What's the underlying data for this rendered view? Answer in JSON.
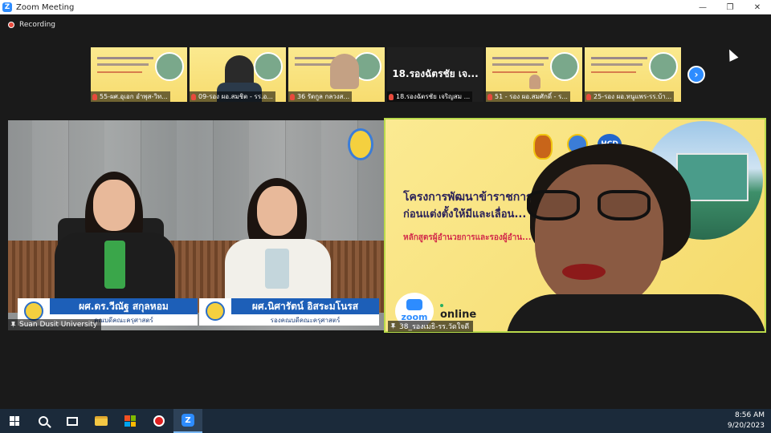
{
  "window": {
    "title": "Zoom Meeting",
    "logo_letter": "Z",
    "minimize": "—",
    "restore": "❐",
    "close": "✕"
  },
  "meeting": {
    "recording_label": "Recording",
    "thumbnails": [
      {
        "label": "55-ผศ.อุเอก อำพุส-วิท..."
      },
      {
        "label": "09-รอง ผอ.สมชิต - รร.อ..."
      },
      {
        "label": "36 รัตกูล กลวงส..."
      },
      {
        "label": "18.รองฉัตรชัย เจริญสม ...",
        "big_name": "18.รองฉัตรชัย เจ..."
      },
      {
        "label": "51 - รอง ผอ.สมศักดิ์ - ร..."
      },
      {
        "label": "25-รอง ผอ.หนูแพร-รร.บ้า..."
      }
    ],
    "next_arrow": "›",
    "left_video": {
      "nameplate_left_name": "ผศ.ดร.วีณัฐ สกุลหอม",
      "nameplate_left_role": "คณบดีคณะครุศาสตร์",
      "nameplate_right_name": "ผศ.นิศารัตน์ อิสระมโนรส",
      "nameplate_right_role": "รองคณบดีคณะครุศาสตร์",
      "participant_name": "Suan Dusit University"
    },
    "right_video": {
      "title_line1": "โครงการพัฒนาข้าราชการค...",
      "title_line2": "ก่อนแต่งตั้งให้มีและเลื่อน...",
      "subtitle": "หลักสูตรผู้อำนวยการและรองผู้อำน...",
      "hcd_label": "HCD",
      "zoom_label": "zoom",
      "online_label": "online",
      "participant_name": "38_รองเมธิ-รร.วัดใจดี"
    }
  },
  "taskbar": {
    "time": "8:56 AM",
    "date": "9/20/2023"
  },
  "colors": {
    "zoom_blue": "#2d8cff",
    "recording_red": "#e84a3c",
    "active_speaker_border": "#b9d94b",
    "taskbar_bg": "#1b2a3a"
  }
}
